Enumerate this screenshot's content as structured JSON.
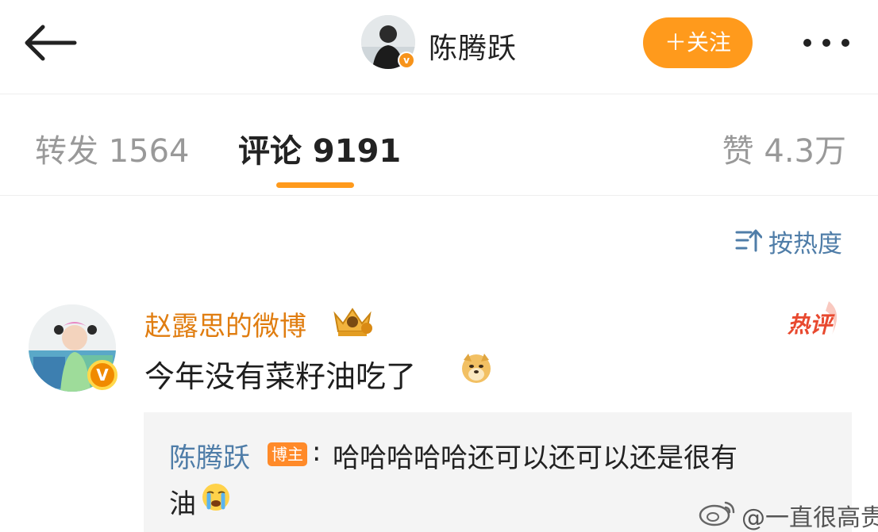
{
  "header": {
    "back_icon": "back-arrow-icon",
    "author_name": "陈腾跃",
    "author_verified_badge": "v",
    "follow_label": "＋关注",
    "more_icon": "more-dots-icon"
  },
  "tabs": [
    {
      "label": "转发 1564",
      "active": false
    },
    {
      "label": "评论 9191",
      "active": true
    },
    {
      "label": "赞 4.3万",
      "active": false
    }
  ],
  "sort": {
    "icon": "sort-icon",
    "label": "按热度"
  },
  "comment": {
    "username": "赵露思的微博",
    "user_badge_icon": "crown-vip-icon",
    "verified_badge": "V",
    "hot_badge": "热评",
    "text": "今年没有菜籽油吃了",
    "emoji": "doge-emoji-icon",
    "reply": {
      "name": "陈腾跃",
      "badge": "博主",
      "colon": ":",
      "text_line1": "哈哈哈哈哈还可以还可以还是很有",
      "text_line2": "油",
      "emoji": "crying-emoji-icon"
    }
  },
  "watermark": {
    "icon": "weibo-logo-icon",
    "text": "@一直很高贵"
  },
  "colors": {
    "accent": "#ff9a1c",
    "link": "#4f7da8",
    "vip_name": "#e07d10",
    "hot": "#e8492f"
  }
}
